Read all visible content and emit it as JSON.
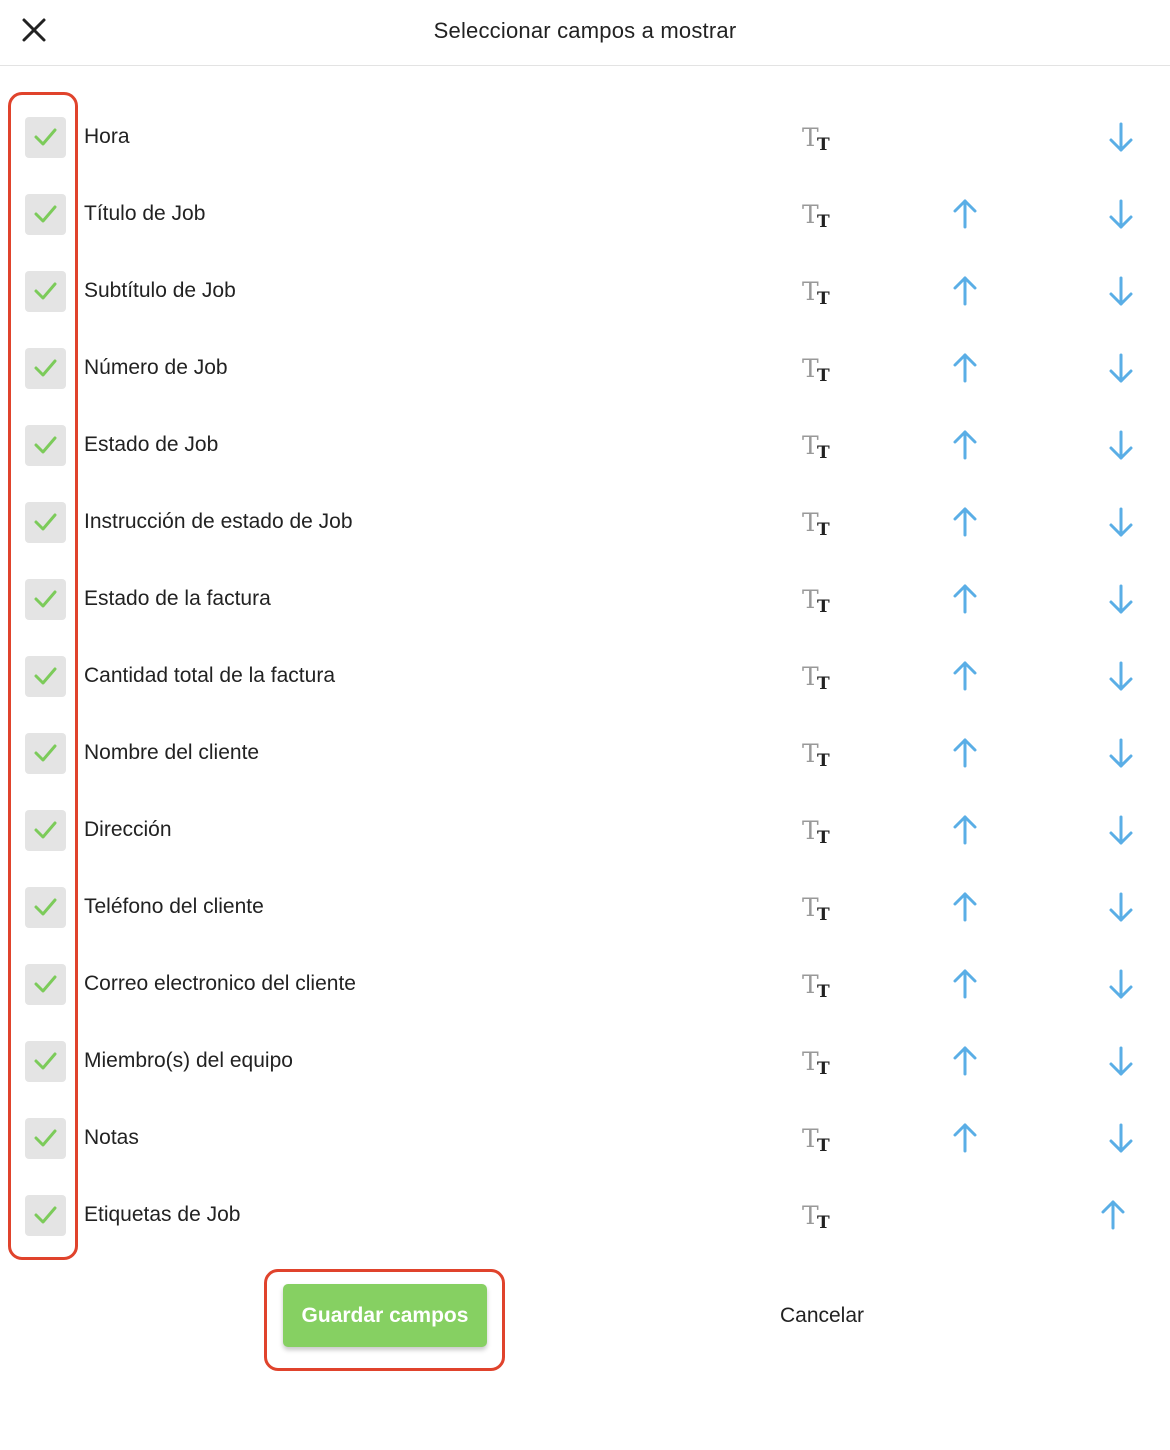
{
  "header": {
    "title": "Seleccionar campos a mostrar",
    "close_icon": "close-icon"
  },
  "fields": [
    {
      "label": "Hora",
      "checked": true,
      "can_move_up": false,
      "can_move_down": true
    },
    {
      "label": "Título de Job",
      "checked": true,
      "can_move_up": true,
      "can_move_down": true
    },
    {
      "label": "Subtítulo de Job",
      "checked": true,
      "can_move_up": true,
      "can_move_down": true
    },
    {
      "label": "Número de Job",
      "checked": true,
      "can_move_up": true,
      "can_move_down": true
    },
    {
      "label": "Estado de Job",
      "checked": true,
      "can_move_up": true,
      "can_move_down": true
    },
    {
      "label": "Instrucción de estado de Job",
      "checked": true,
      "can_move_up": true,
      "can_move_down": true
    },
    {
      "label": "Estado de la factura",
      "checked": true,
      "can_move_up": true,
      "can_move_down": true
    },
    {
      "label": "Cantidad total de la factura",
      "checked": true,
      "can_move_up": true,
      "can_move_down": true
    },
    {
      "label": "Nombre del cliente",
      "checked": true,
      "can_move_up": true,
      "can_move_down": true
    },
    {
      "label": "Dirección",
      "checked": true,
      "can_move_up": true,
      "can_move_down": true
    },
    {
      "label": "Teléfono del cliente",
      "checked": true,
      "can_move_up": true,
      "can_move_down": true
    },
    {
      "label": "Correo electronico del cliente",
      "checked": true,
      "can_move_up": true,
      "can_move_down": true
    },
    {
      "label": "Miembro(s) del equipo",
      "checked": true,
      "can_move_up": true,
      "can_move_down": true
    },
    {
      "label": "Notas",
      "checked": true,
      "can_move_up": true,
      "can_move_down": true
    },
    {
      "label": "Etiquetas de Job",
      "checked": true,
      "can_move_up": true,
      "can_move_down": false
    }
  ],
  "icons": {
    "checkbox": "check-icon",
    "format": "text-format-icon",
    "up": "arrow-up-icon",
    "down": "arrow-down-icon"
  },
  "actions": {
    "save_label": "Guardar campos",
    "cancel_label": "Cancelar"
  },
  "colors": {
    "check": "#7ccb5a",
    "checkbox_bg": "#e4e4e4",
    "arrow": "#5aaee6",
    "save_button": "#86d062",
    "highlight": "#e0432c"
  }
}
